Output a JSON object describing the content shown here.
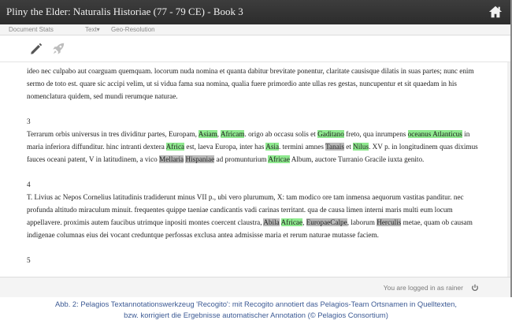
{
  "window": {
    "title": "Pliny the Elder: Naturalis Historiae (77 - 79 CE) - Book 3"
  },
  "menu": {
    "items": [
      "Document Stats",
      "Text▾",
      "Geo-Resolution"
    ]
  },
  "toolbar": {
    "tools": [
      "pencil-icon",
      "rocket-icon"
    ]
  },
  "content": {
    "intro": [
      {
        "t": "ideo nec culpabo aut coarguam quemquam. locorum nuda nomina et quanta dabitur brevitate ponentur, claritate causisque dilatis in suas partes; nunc enim sermo de toto est. quare sic accipi velim, ut si vidua fama sua nomina, qualia fuere primordio ante ullas res gestas, nuncupentur et sit quaedam in his nomenclatura quidem, sed mundi rerumque naturae."
      }
    ],
    "p3_num": "3",
    "p3": [
      {
        "t": "Terrarum orbis universus in tres dividitur partes, Europam, "
      },
      {
        "t": "Asiam",
        "h": "g"
      },
      {
        "t": ", "
      },
      {
        "t": "Africam",
        "h": "g"
      },
      {
        "t": ". origo ab occasu solis et "
      },
      {
        "t": "Gaditano",
        "h": "g"
      },
      {
        "t": " freto, qua inrumpens "
      },
      {
        "t": "oceanus Atlanticus",
        "h": "g"
      },
      {
        "t": " in maria inferiora diffunditur. hinc intranti dextera "
      },
      {
        "t": "Africa",
        "h": "g"
      },
      {
        "t": " est, laeva Europa, inter has "
      },
      {
        "t": "Asia",
        "h": "g"
      },
      {
        "t": ". termini amnes "
      },
      {
        "t": "Tanais",
        "h": "grey"
      },
      {
        "t": " et "
      },
      {
        "t": "Nilus",
        "h": "g"
      },
      {
        "t": ". XV p. in longitudinem quas diximus fauces oceani patent, V in latitudinem, a vico "
      },
      {
        "t": "Mellaria",
        "h": "grey"
      },
      {
        "t": " "
      },
      {
        "t": "Hispaniae",
        "h": "grey"
      },
      {
        "t": " ad promunturium "
      },
      {
        "t": "Africae",
        "h": "g"
      },
      {
        "t": " Album, auctore Turranio Gracile iuxta genito."
      }
    ],
    "p4_num": "4",
    "p4": [
      {
        "t": "T. Livius ac Nepos Cornelius latitudinis tradiderunt minus VII p., ubi vero plurumum, X: tam modico ore tam inmensa aequorum vastitas panditur. nec profunda altitudo miraculum minuit. frequentes quippe taeniae candicantis vadi carinas territant. qua de causa limen interni maris multi eum locum appellavere. proximis autem faucibus utrimque inpositi montes coercent claustra, "
      },
      {
        "t": "Abila",
        "h": "grey"
      },
      {
        "t": " "
      },
      {
        "t": "Africae",
        "h": "g"
      },
      {
        "t": ", "
      },
      {
        "t": "EuropaeCalpe",
        "h": "grey"
      },
      {
        "t": ", laborum "
      },
      {
        "t": "Herculis",
        "h": "grey"
      },
      {
        "t": " metae, quam ob causam indigenae columnas eius dei vocant creduntque perfossas exclusa antea admisisse maria et rerum naturae mutasse faciem."
      }
    ],
    "p5_num": "5"
  },
  "footer": {
    "login_text": "You are logged in as rainer"
  },
  "caption": {
    "line1": "Abb. 2: Pelagios Textannotationswerkzeug 'Recogito': mit Recogito annotiert das Pelagios-Team Ortsnamen in Quelltexten,",
    "line2": "bzw. korrigiert die Ergebnisse automatischer Annotation (© Pelagios Consortium)"
  },
  "colors": {
    "highlight_green": "#8fe98f",
    "highlight_grey": "#b9b9b9",
    "titlebar": "#333333",
    "caption": "#3c5a94"
  }
}
